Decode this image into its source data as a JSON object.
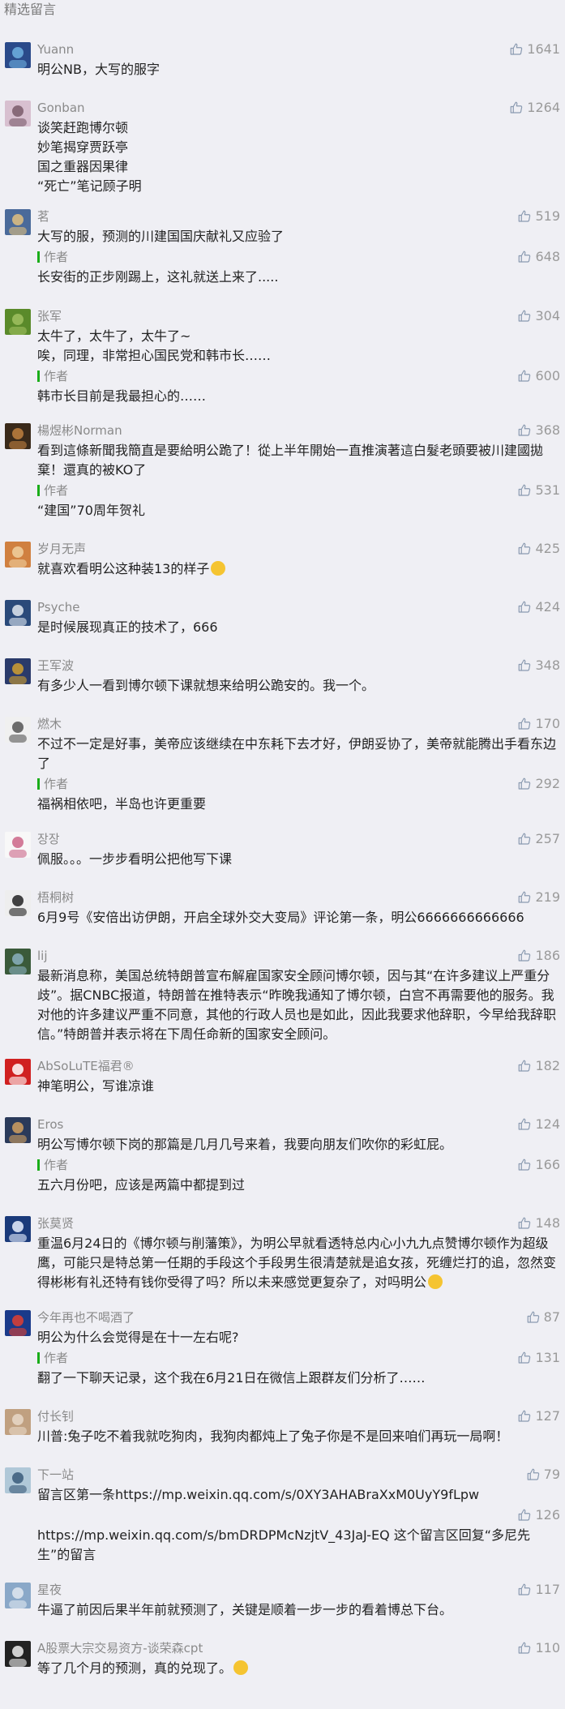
{
  "section_title": "精选留言",
  "comments": [
    {
      "nick": "Yuann",
      "likes": "1641",
      "text": "明公NB，大写的服字"
    },
    {
      "nick": "Gonban",
      "likes": "1264",
      "text": "谈笑赶跑博尔顿\n妙笔揭穿贾跃亭\n国之重器因果律\n“死亡”笔记顾子明"
    },
    {
      "nick": "茗",
      "likes": "519",
      "text": "大写的服，预测的川建国国庆献礼又应验了",
      "reply": {
        "tag": "作者",
        "likes": "648",
        "text": "长安街的正步刚踢上，这礼就送上来了....."
      }
    },
    {
      "nick": "张军",
      "likes": "304",
      "text": "太牛了，太牛了，太牛了~\n唉，同理，非常担心国民党和韩市长……",
      "reply": {
        "tag": "作者",
        "likes": "600",
        "text": "韩市长目前是我最担心的……"
      }
    },
    {
      "nick": "楊煜彬Norman",
      "likes": "368",
      "text": "看到這條新聞我簡直是要給明公跪了！從上半年開始一直推演著這白髮老頭要被川建國拋棄！還真的被KO了",
      "reply": {
        "tag": "作者",
        "likes": "531",
        "text": "“建国”70周年贺礼"
      }
    },
    {
      "nick": "岁月无声",
      "likes": "425",
      "text": "就喜欢看明公这种装13的样子"
    },
    {
      "nick": "Psyche",
      "likes": "424",
      "text": "是时候展现真正的技术了，666"
    },
    {
      "nick": "王军波",
      "likes": "348",
      "text": "有多少人一看到博尔顿下课就想来给明公跪安的。我一个。"
    },
    {
      "nick": "燃木",
      "likes": "170",
      "text": "不过不一定是好事，美帝应该继续在中东耗下去才好，伊朗妥协了，美帝就能腾出手看东边了",
      "reply": {
        "tag": "作者",
        "likes": "292",
        "text": "福祸相依吧，半岛也许更重要"
      }
    },
    {
      "nick": "장장",
      "likes": "257",
      "text": "佩服。。。一步步看明公把他写下课"
    },
    {
      "nick": "梧桐树",
      "likes": "219",
      "text": "6月9号《安倍出访伊朗，开启全球外交大变局》评论第一条，明公6666666666666"
    },
    {
      "nick": "lij",
      "likes": "186",
      "text": "最新消息称，美国总统特朗普宣布解雇国家安全顾问博尔顿，因与其“在许多建议上严重分歧”。据CNBC报道，特朗普在推特表示“昨晚我通知了博尔顿，白宫不再需要他的服务。我对他的许多建议严重不同意，其他的行政人员也是如此，因此我要求他辞职，今早给我辞职信。”特朗普并表示将在下周任命新的国家安全顾问。"
    },
    {
      "nick": "AbSoLuTE福君®",
      "likes": "182",
      "text": "神笔明公，写谁凉谁"
    },
    {
      "nick": "Eros",
      "likes": "124",
      "text": "明公写博尔顿下岗的那篇是几月几号来着，我要向朋友们吹你的彩虹屁。",
      "reply": {
        "tag": "作者",
        "likes": "166",
        "text": "五六月份吧，应该是两篇中都提到过"
      }
    },
    {
      "nick": "张莫贤",
      "likes": "148",
      "text": "重温6月24日的《博尔顿与削藩策》，为明公早就看透特总内心小九九点赞博尔顿作为超级鹰，可能只是特总第一任期的手段这个手段男生很清楚就是追女孩，死缠烂打的追，忽然变得彬彬有礼还特有钱你受得了吗？所以未来感觉更复杂了，对吗明公"
    },
    {
      "nick": "今年再也不喝酒了",
      "likes": "87",
      "text": "明公为什么会觉得是在十一左右呢?",
      "reply": {
        "tag": "作者",
        "likes": "131",
        "text": "翻了一下聊天记录，这个我在6月21日在微信上跟群友们分析了……"
      }
    },
    {
      "nick": "付长钊",
      "likes": "127",
      "text": "川普:兔子吃不着我就吃狗肉，我狗肉都炖上了兔子你是不是回来咱们再玩一局啊！"
    },
    {
      "nick": "下一站",
      "likes": "79",
      "text": "留言区第一条https://mp.weixin.qq.com/s/0XY3AHABraXxM0UyY9fLpw",
      "reply": {
        "tag": "",
        "likes": "126",
        "text": "https://mp.weixin.qq.com/s/bmDRDPMcNzjtV_43JaJ-EQ 这个留言区回复“多尼先生”的留言"
      }
    },
    {
      "nick": "星夜",
      "likes": "117",
      "text": "牛逼了前因后果半年前就预测了，关键是顺着一步一步的看着博总下台。"
    },
    {
      "nick": "A股票大宗交易资方-谈荣森cpt",
      "likes": "110",
      "text": "等了几个月的预测，真的兑现了。"
    }
  ],
  "colors": {
    "accent_green": "#1aad19",
    "background": "#efeff4"
  }
}
